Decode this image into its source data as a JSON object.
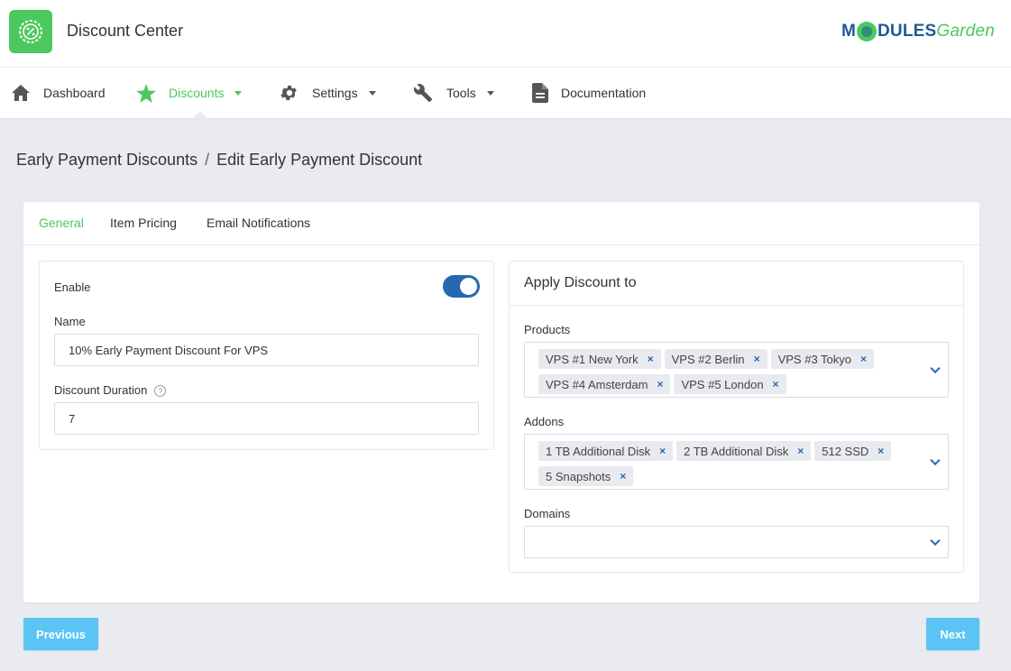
{
  "header": {
    "app_title": "Discount Center",
    "brand": {
      "part1": "M",
      "part2": "DULES",
      "part3": "Garden"
    },
    "logo_icon": "percent-badge-icon"
  },
  "nav": {
    "items": [
      {
        "label": "Dashboard",
        "icon": "home-icon",
        "dropdown": false,
        "active": false
      },
      {
        "label": "Discounts",
        "icon": "star-icon",
        "dropdown": true,
        "active": true
      },
      {
        "label": "Settings",
        "icon": "gear-icon",
        "dropdown": true,
        "active": false
      },
      {
        "label": "Tools",
        "icon": "wrench-icon",
        "dropdown": true,
        "active": false
      },
      {
        "label": "Documentation",
        "icon": "document-icon",
        "dropdown": false,
        "active": false
      }
    ]
  },
  "breadcrumb": {
    "parent": "Early Payment Discounts",
    "separator": "/",
    "current": "Edit Early Payment Discount"
  },
  "tabs": [
    {
      "label": "General",
      "active": true
    },
    {
      "label": "Item Pricing",
      "active": false
    },
    {
      "label": "Email Notifications",
      "active": false
    }
  ],
  "general": {
    "enable_label": "Enable",
    "enable_value": true,
    "name_label": "Name",
    "name_value": "10% Early Payment Discount For VPS",
    "duration_label": "Discount Duration",
    "duration_help": "?",
    "duration_value": "7"
  },
  "apply": {
    "title": "Apply Discount to",
    "products_label": "Products",
    "products": [
      "VPS #1 New York",
      "VPS #2 Berlin",
      "VPS #3 Tokyo",
      "VPS #4 Amsterdam",
      "VPS #5 London"
    ],
    "addons_label": "Addons",
    "addons": [
      "1 TB Additional Disk",
      "2 TB Additional Disk",
      "512 SSD",
      "5 Snapshots"
    ],
    "domains_label": "Domains",
    "domains": [],
    "remove_glyph": "×"
  },
  "footer": {
    "previous_label": "Previous",
    "next_label": "Next"
  },
  "colors": {
    "accent_green": "#4cc85e",
    "primary_blue": "#2568b0",
    "button_blue": "#5bc4f5"
  }
}
